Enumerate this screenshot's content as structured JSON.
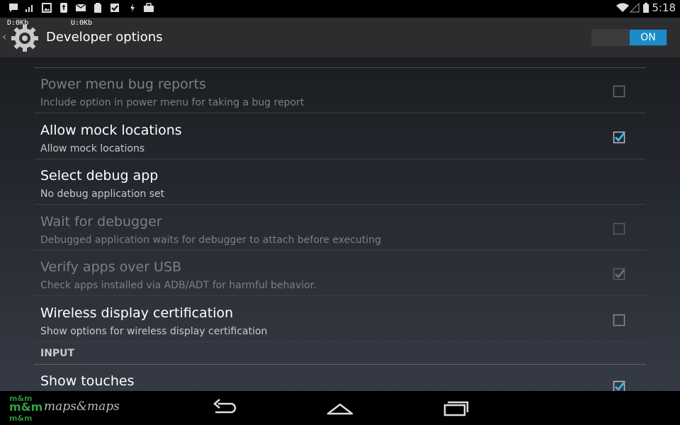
{
  "status_bar": {
    "time": "5:18",
    "left_icons": [
      "chat-icon",
      "signal-bars-icon",
      "image-icon",
      "usb-debug-icon",
      "email-icon",
      "clipboard-icon",
      "checkbox-icon",
      "flash-icon",
      "briefcase-icon"
    ],
    "right_icons": [
      "wifi-icon",
      "cell-signal-icon",
      "battery-icon"
    ]
  },
  "traffic": {
    "download": "D:0Kb",
    "upload": "U:0Kb"
  },
  "action_bar": {
    "title": "Developer options",
    "toggle_label": "ON",
    "accent": "#1b8bc9"
  },
  "settings": [
    {
      "title": "Power menu bug reports",
      "summary": "Include option in power menu for taking a bug report",
      "checkbox": true,
      "checked": false,
      "enabled": false
    },
    {
      "title": "Allow mock locations",
      "summary": "Allow mock locations",
      "checkbox": true,
      "checked": true,
      "enabled": true
    },
    {
      "title": "Select debug app",
      "summary": "No debug application set",
      "checkbox": false,
      "checked": false,
      "enabled": true
    },
    {
      "title": "Wait for debugger",
      "summary": "Debugged application waits for debugger to attach before executing",
      "checkbox": true,
      "checked": false,
      "enabled": false
    },
    {
      "title": "Verify apps over USB",
      "summary": "Check apps installed via ADB/ADT for harmful behavior.",
      "checkbox": true,
      "checked": true,
      "enabled": false
    },
    {
      "title": "Wireless display certification",
      "summary": "Show options for wireless display certification",
      "checkbox": true,
      "checked": false,
      "enabled": true
    }
  ],
  "section_header": "INPUT",
  "input_settings": [
    {
      "title": "Show touches",
      "checkbox": true,
      "checked": true,
      "enabled": true
    }
  ],
  "nav_bar": {
    "logo_text": "maps&maps",
    "logo_mark": "m&m",
    "buttons": [
      "back-icon",
      "home-icon",
      "recent-apps-icon"
    ]
  }
}
